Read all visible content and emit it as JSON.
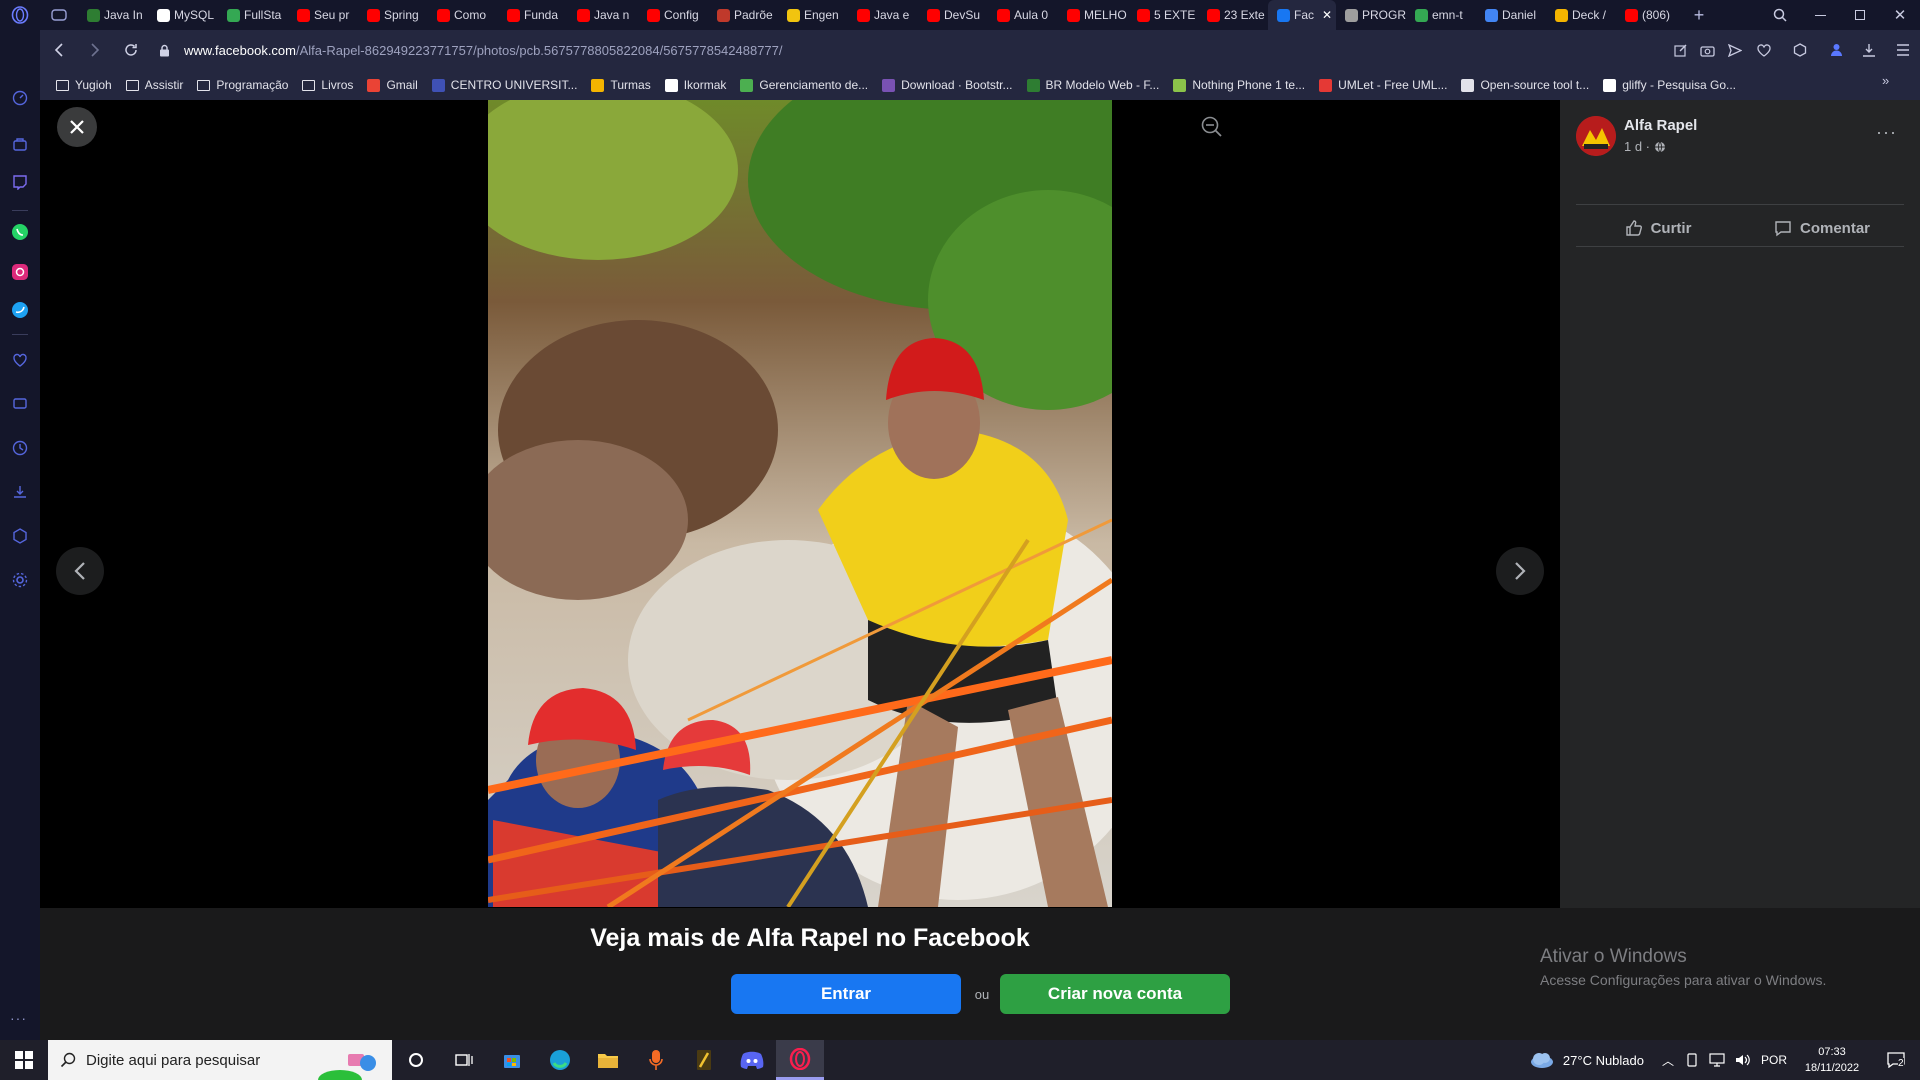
{
  "tabs": [
    {
      "label": "Java In",
      "color": "#2e7d32"
    },
    {
      "label": "MySQL",
      "color": "#ffffff"
    },
    {
      "label": "FullSta",
      "color": "#34a853"
    },
    {
      "label": "Seu pr",
      "color": "#ff0000"
    },
    {
      "label": "Spring",
      "color": "#ff0000"
    },
    {
      "label": "Como",
      "color": "#ff0000"
    },
    {
      "label": "Funda",
      "color": "#ff0000"
    },
    {
      "label": "Java n",
      "color": "#ff0000"
    },
    {
      "label": "Config",
      "color": "#ff0000"
    },
    {
      "label": "Padrõe",
      "color": "#c0392b"
    },
    {
      "label": "Engen",
      "color": "#f1c40f"
    },
    {
      "label": "Java e",
      "color": "#ff0000"
    },
    {
      "label": "DevSu",
      "color": "#ff0000"
    },
    {
      "label": "Aula 0",
      "color": "#ff0000"
    },
    {
      "label": "MELHO",
      "color": "#ff0000"
    },
    {
      "label": "5 EXTE",
      "color": "#ff0000"
    },
    {
      "label": "23 Exte",
      "color": "#ff0000"
    },
    {
      "label": "Fac",
      "color": "#1877f2",
      "active": true
    },
    {
      "label": "PROGR",
      "color": "#9e9e9e"
    },
    {
      "label": "emn-t",
      "color": "#34a853"
    },
    {
      "label": "Daniel",
      "color": "#4285f4"
    },
    {
      "label": "Deck /",
      "color": "#f4b400"
    },
    {
      "label": "(806)",
      "color": "#ff0000"
    }
  ],
  "address": {
    "domain": "www.facebook.com",
    "path": "/Alfa-Rapel-862949223771757/photos/pcb.5675778805822084/5675778542488777/"
  },
  "bookmarks": [
    {
      "label": "Yugioh",
      "icon": "folder-icon",
      "color": "#e2e2ea"
    },
    {
      "label": "Assistir",
      "icon": "folder-icon",
      "color": "#e2e2ea"
    },
    {
      "label": "Programação",
      "icon": "folder-icon",
      "color": "#e2e2ea"
    },
    {
      "label": "Livros",
      "icon": "folder-icon",
      "color": "#e2e2ea"
    },
    {
      "label": "Gmail",
      "icon": "gmail-icon",
      "color": "#ea4335"
    },
    {
      "label": "CENTRO UNIVERSIT...",
      "icon": "globe-icon",
      "color": "#3f51b5"
    },
    {
      "label": "Turmas",
      "icon": "classroom-icon",
      "color": "#f4b400"
    },
    {
      "label": "Ikormak",
      "icon": "github-icon",
      "color": "#ffffff"
    },
    {
      "label": "Gerenciamento de...",
      "icon": "leaf-icon",
      "color": "#4caf50"
    },
    {
      "label": "Download · Bootstr...",
      "icon": "bootstrap-icon",
      "color": "#7952b3"
    },
    {
      "label": "BR Modelo Web - F...",
      "icon": "brmodelo-icon",
      "color": "#2e7d32"
    },
    {
      "label": "Nothing Phone 1 te...",
      "icon": "t-icon",
      "color": "#8bc34a"
    },
    {
      "label": "UMLet - Free UML...",
      "icon": "umlet-icon",
      "color": "#e53935"
    },
    {
      "label": "Open-source tool t...",
      "icon": "tool-icon",
      "color": "#e2e2ea"
    },
    {
      "label": "gliffy - Pesquisa Go...",
      "icon": "google-icon",
      "color": "#ffffff"
    }
  ],
  "post": {
    "author": "Alfa Rapel",
    "time": "1 d ·",
    "like_label": "Curtir",
    "comment_label": "Comentar"
  },
  "signup": {
    "heading": "Veja mais de Alfa Rapel no Facebook",
    "login_label": "Entrar",
    "or_label": "ou",
    "create_label": "Criar nova conta"
  },
  "activation": {
    "title": "Ativar o Windows",
    "subtitle": "Acesse Configurações para ativar o Windows."
  },
  "taskbar": {
    "search_placeholder": "Digite aqui para pesquisar",
    "weather": "27°C  Nublado",
    "lang": "POR",
    "time": "07:33",
    "date": "18/11/2022",
    "notifications": "2"
  },
  "colors": {
    "facebook_blue": "#1877f2",
    "create_green": "#2ea043",
    "panel_bg": "#242526"
  }
}
